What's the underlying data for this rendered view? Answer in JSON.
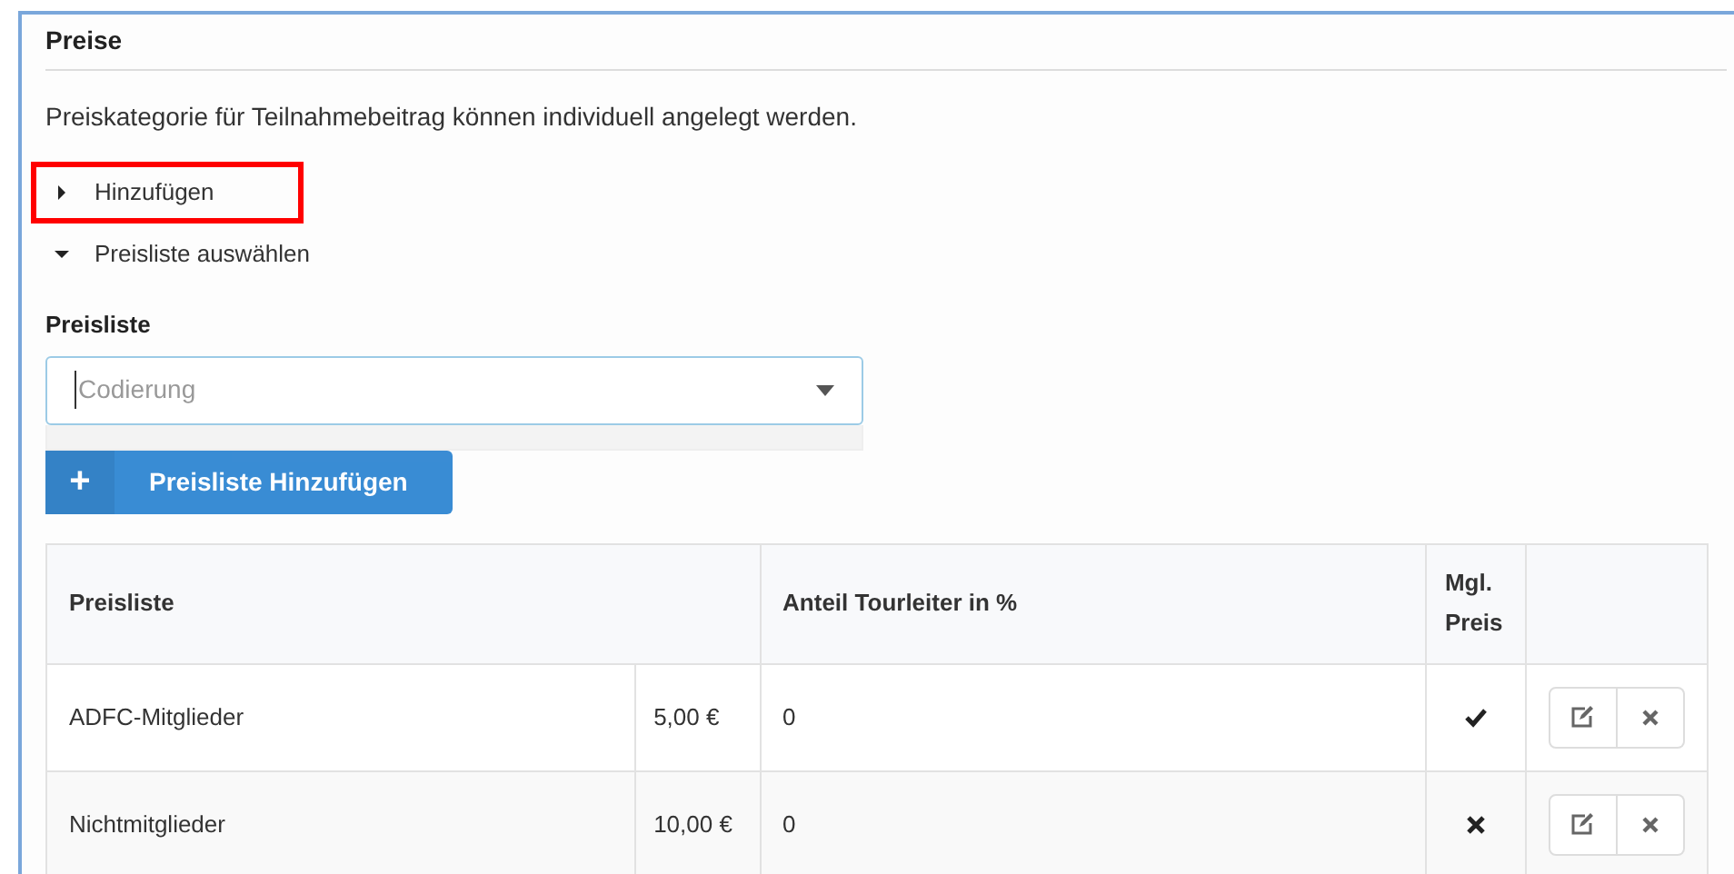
{
  "section": {
    "title": "Preise",
    "description": "Preiskategorie für Teilnahmebeitrag können individuell angelegt werden."
  },
  "toggles": [
    {
      "label": "Hinzufügen",
      "expanded": false,
      "highlighted": true
    },
    {
      "label": "Preisliste auswählen",
      "expanded": true,
      "highlighted": false
    }
  ],
  "select": {
    "label": "Preisliste",
    "placeholder": "Codierung",
    "open": true
  },
  "add_button": {
    "icon": "+",
    "label": "Preisliste Hinzufügen"
  },
  "table": {
    "columns": [
      "Preisliste",
      "Anteil Tourleiter in %",
      "Mgl. Preis"
    ],
    "rows": [
      {
        "name": "ADFC-Mitglieder",
        "price": "5,00 €",
        "share": "0",
        "member_price": true
      },
      {
        "name": "Nichtmitglieder",
        "price": "10,00 €",
        "share": "0",
        "member_price": false
      }
    ]
  }
}
